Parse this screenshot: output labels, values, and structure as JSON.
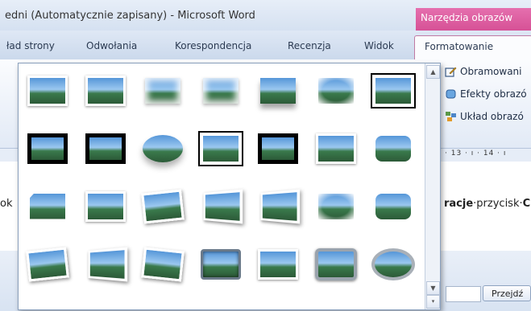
{
  "window": {
    "title": "edni (Automatycznie zapisany)  -  Microsoft Word"
  },
  "context_tab": {
    "group_label": "Narzędzia obrazów",
    "tab_label": "Formatowanie"
  },
  "tabs": [
    "ład strony",
    "Odwołania",
    "Korespondencja",
    "Recenzja",
    "Widok"
  ],
  "ribbon_commands": [
    {
      "label": "Obramowani",
      "icon": "pencil-border-icon"
    },
    {
      "label": "Efekty obrazó",
      "icon": "picture-effects-icon"
    },
    {
      "label": "Układ obrazó",
      "icon": "picture-layout-icon"
    }
  ],
  "ruler": {
    "text": "· 13 · ı · 14 · ı"
  },
  "document": {
    "left_fragment": "ok",
    "line_bold1": "racje",
    "line_mid": "·przycisk·",
    "line_bold2": "C"
  },
  "find": {
    "button_label": "Przejdź",
    "input_value": ""
  },
  "gallery": {
    "name": "picture-styles-gallery",
    "rows": 4,
    "cols": 7,
    "styles": [
      "white-frame",
      "white-frame",
      "soft-frame",
      "soft-edge",
      "soft-shadow",
      "fade-edge",
      "black-double",
      "thick-black",
      "black",
      "oval-shadow",
      "double-black",
      "thick-black-2",
      "white-shadow",
      "rounded",
      "cut-corner",
      "white-frame-shadow",
      "tilt-left",
      "perspective",
      "perspective-white",
      "soft-oval",
      "rounded-shadow",
      "bevel-rect",
      "perspective-left",
      "tilt-right",
      "bevel-dark",
      "soft-white",
      "metal-frame",
      "metal-oval"
    ]
  }
}
